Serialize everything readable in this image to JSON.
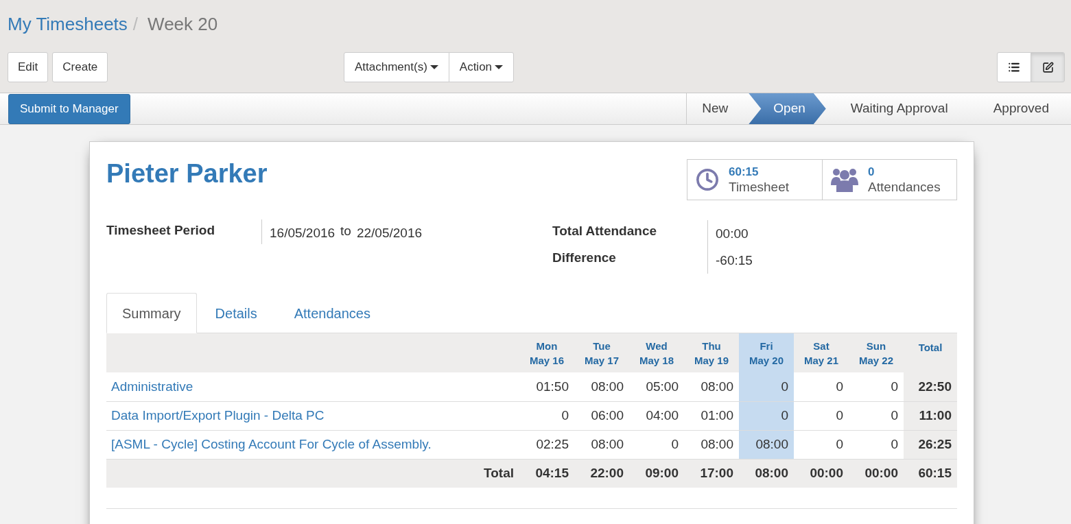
{
  "breadcrumb": [
    {
      "label": "My Timesheets",
      "link": true
    },
    {
      "label": "Week 20",
      "link": false
    }
  ],
  "breadcrumb_separator": "/",
  "buttons_left": [
    "Edit",
    "Create"
  ],
  "dropdowns": [
    "Attachment(s)",
    "Action"
  ],
  "view_switch": [
    {
      "kind": "list",
      "selected": false
    },
    {
      "kind": "form",
      "selected": true
    }
  ],
  "submit_button": "Submit to Manager",
  "stages": [
    {
      "label": "New",
      "selected": false
    },
    {
      "label": "Open",
      "selected": true
    },
    {
      "label": "Waiting Approval",
      "selected": false
    },
    {
      "label": "Approved",
      "selected": false
    }
  ],
  "employee": "Pieter Parker",
  "smart_buttons": [
    {
      "kind": "clock",
      "value": "60:15",
      "label": "Timesheet"
    },
    {
      "kind": "people",
      "value": "0",
      "label": "Attendances"
    }
  ],
  "period": {
    "label": "Timesheet Period",
    "from": "16/05/2016",
    "to_word": "to",
    "to": "22/05/2016"
  },
  "totals": [
    {
      "label": "Total Attendance",
      "value": "00:00"
    },
    {
      "label": "Difference",
      "value": "-60:15"
    }
  ],
  "tabs": [
    {
      "label": "Summary",
      "selected": true
    },
    {
      "label": "Details",
      "selected": false
    },
    {
      "label": "Attendances",
      "selected": false
    }
  ],
  "summary": {
    "days": [
      {
        "day": "Mon",
        "date": "May 16",
        "today": false
      },
      {
        "day": "Tue",
        "date": "May 17",
        "today": false
      },
      {
        "day": "Wed",
        "date": "May 18",
        "today": false
      },
      {
        "day": "Thu",
        "date": "May 19",
        "today": false
      },
      {
        "day": "Fri",
        "date": "May 20",
        "today": true
      },
      {
        "day": "Sat",
        "date": "May 21",
        "today": false
      },
      {
        "day": "Sun",
        "date": "May 22",
        "today": false
      }
    ],
    "total_header": "Total",
    "rows": [
      {
        "name": "Administrative",
        "values": [
          "01:50",
          "08:00",
          "05:00",
          "08:00",
          "0",
          "0",
          "0"
        ],
        "total": "22:50"
      },
      {
        "name": "Data Import/Export Plugin - Delta PC",
        "values": [
          "0",
          "06:00",
          "04:00",
          "01:00",
          "0",
          "0",
          "0"
        ],
        "total": "11:00"
      },
      {
        "name": "[ASML - Cycle] Costing Account For Cycle of Assembly.",
        "values": [
          "02:25",
          "08:00",
          "0",
          "08:00",
          "08:00",
          "0",
          "0"
        ],
        "total": "26:25"
      }
    ],
    "footer_label": "Total",
    "footer_values": [
      "04:15",
      "22:00",
      "09:00",
      "17:00",
      "08:00",
      "00:00",
      "00:00"
    ],
    "footer_total": "60:15"
  }
}
